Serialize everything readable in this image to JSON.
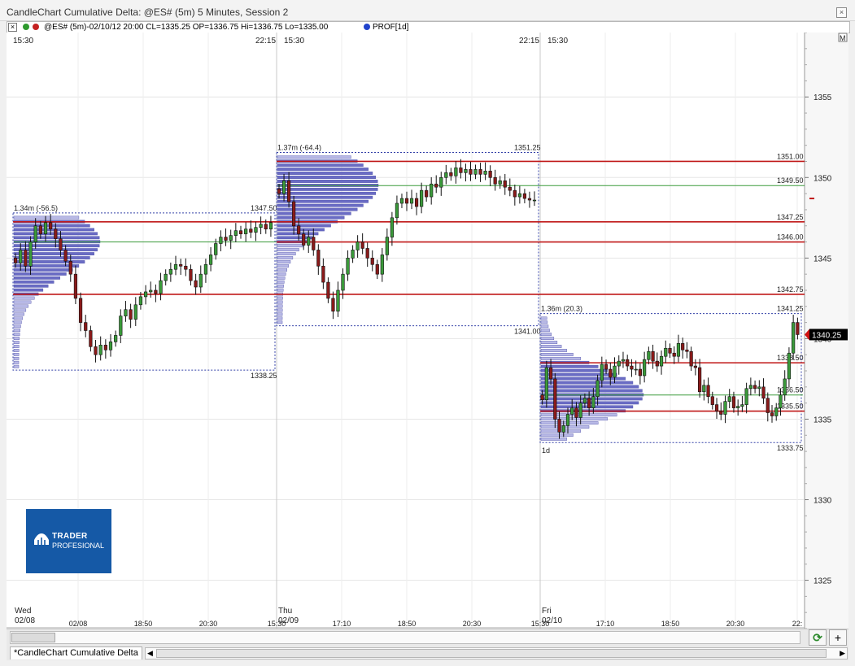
{
  "window": {
    "title": "CandleChart Cumulative Delta: @ES# (5m) 5 Minutes, Session 2",
    "close_glyph": "×"
  },
  "legend": {
    "close_glyph": "×",
    "symbol_text": "@ES# (5m)-02/10/12 20:00 CL=1335.25 OP=1336.75 Hi=1336.75 Lo=1335.00",
    "profile_text": "PROF[1d]",
    "dot_colors": [
      "#2e9a2e",
      "#c42020",
      "#2244cc"
    ]
  },
  "chart_data": {
    "type": "candlestick",
    "y_ticks": [
      1355,
      1350,
      1345,
      1340,
      1335,
      1330,
      1325
    ],
    "y_tick_labels": [
      "1355",
      "1350",
      "1345",
      "1340",
      "1335",
      "1330",
      "1325"
    ],
    "ylim": [
      1322,
      1359
    ],
    "last_price": "1340.25",
    "axis_corner": "M",
    "grid": true,
    "sessions": [
      {
        "day": "Wed",
        "date": "02/08",
        "start_label": "15:30",
        "end_label": "22:15",
        "profile_label": "1.34m (-56.5)",
        "high": 1347.5,
        "low": 1338.25,
        "high_label": "1347.50",
        "low_label": "1338.25",
        "poc": 1346.0,
        "poc_label": "1346.00",
        "va_high": 1347.25,
        "va_low": 1342.75
      },
      {
        "day": "Thu",
        "date": "02/09",
        "start_label": "15:30",
        "end_label": "22:15",
        "profile_label": "1.37m (-64.4)",
        "high": 1351.25,
        "low": 1341.0,
        "high_label": "1351.25",
        "low_label": "1341.00",
        "poc": 1349.5,
        "poc_label": "1349.50",
        "va_high": 1351.0,
        "va_low": 1346.0
      },
      {
        "day": "Fri",
        "date": "02/10",
        "start_label": "15:30",
        "end_label": "",
        "profile_label": "1.36m (20.3)",
        "high": 1341.25,
        "low": 1333.75,
        "high_label": "1341.25",
        "low_label": "1333.75",
        "poc": 1336.5,
        "poc_label": "1336.50",
        "va_high": 1338.5,
        "va_low": 1335.5,
        "profile_period": "1d"
      }
    ],
    "levels": [
      {
        "value": 1351.0,
        "label": "1351.00",
        "kind": "value-area"
      },
      {
        "value": 1349.5,
        "label": "1349.50",
        "kind": "poc"
      },
      {
        "value": 1347.25,
        "label": "1347.25",
        "kind": "value-area"
      },
      {
        "value": 1346.0,
        "label": "1346.00",
        "kind": "value-area"
      },
      {
        "value": 1342.75,
        "label": "1342.75",
        "kind": "value-area"
      },
      {
        "value": 1338.5,
        "label": "1338.50",
        "kind": "value-area"
      },
      {
        "value": 1336.5,
        "label": "1336.50",
        "kind": "poc"
      },
      {
        "value": 1335.5,
        "label": "1335.50",
        "kind": "value-area"
      }
    ],
    "time_labels": [
      "02/08",
      "18:50",
      "20:30",
      "15:30",
      "17:10",
      "18:50",
      "20:30",
      "15:30",
      "17:10",
      "18:50",
      "20:30",
      "22:"
    ],
    "closes": [
      [
        1344.7,
        1345.5,
        1344.5,
        1346,
        1347,
        1346.5,
        1347.2,
        1346.8,
        1346.2,
        1345.5,
        1344.8,
        1344,
        1342.5,
        1341,
        1340.5,
        1339.5,
        1339,
        1339.6,
        1339.3,
        1339.8,
        1340.2,
        1341.4,
        1341.8,
        1341.2,
        1342.1,
        1342.6,
        1342.9,
        1343,
        1342.8,
        1343.6,
        1344,
        1344.3,
        1344.6,
        1344.5,
        1344.3,
        1343.6,
        1343.2,
        1344,
        1344.6,
        1345.2,
        1345.9,
        1346.3,
        1346.1,
        1346.4,
        1346.7,
        1346.5,
        1346.8,
        1346.6,
        1346.9,
        1347.1,
        1346.8,
        1347.2
      ],
      [
        1349,
        1349.8,
        1348.5,
        1347,
        1346.5,
        1345.8,
        1346.3,
        1345.5,
        1344.5,
        1343.5,
        1342.5,
        1341.7,
        1343,
        1344,
        1345,
        1345.5,
        1346,
        1345.6,
        1345,
        1344.6,
        1344,
        1345.2,
        1346.3,
        1347.5,
        1348.4,
        1348.7,
        1348.4,
        1348.7,
        1348.2,
        1349.2,
        1348.8,
        1349.6,
        1349.4,
        1350,
        1350.3,
        1350.1,
        1350.6,
        1350.3,
        1350.5,
        1350.2,
        1350.5,
        1350.2,
        1350.4,
        1350,
        1349.6,
        1349.8,
        1349.4,
        1349.2,
        1348.8,
        1349,
        1348.7,
        1348.6,
        1348.6
      ],
      [
        1336.2,
        1338.2,
        1337.5,
        1335,
        1334.2,
        1334.6,
        1335.3,
        1335.7,
        1335.1,
        1336,
        1336.3,
        1335.7,
        1336.4,
        1337.4,
        1338.4,
        1338.1,
        1337.6,
        1338.3,
        1338.6,
        1338.7,
        1338.3,
        1338.1,
        1338.1,
        1337.7,
        1338.7,
        1339.2,
        1338.6,
        1338.3,
        1338.9,
        1339.4,
        1339.1,
        1338.9,
        1339.7,
        1339.3,
        1339.2,
        1338.3,
        1338.2,
        1336.7,
        1337.1,
        1336.4,
        1335.9,
        1335.5,
        1335.3,
        1336.1,
        1336.4,
        1335.7,
        1335.8,
        1335.9,
        1336.9,
        1337.1,
        1336.9,
        1337,
        1336.3,
        1335.4,
        1335.2,
        1335.7,
        1336.5,
        1337.5,
        1339.1,
        1341,
        1340.25
      ]
    ]
  },
  "logo": {
    "line1": "TRADER",
    "line2": "PROFESIONAL"
  },
  "bottom": {
    "refresh_glyph": "⟳",
    "add_glyph": "+"
  },
  "tabs": {
    "active": "*CandleChart Cumulative Delta",
    "left_arrow": "◀",
    "right_arrow": "▶"
  }
}
